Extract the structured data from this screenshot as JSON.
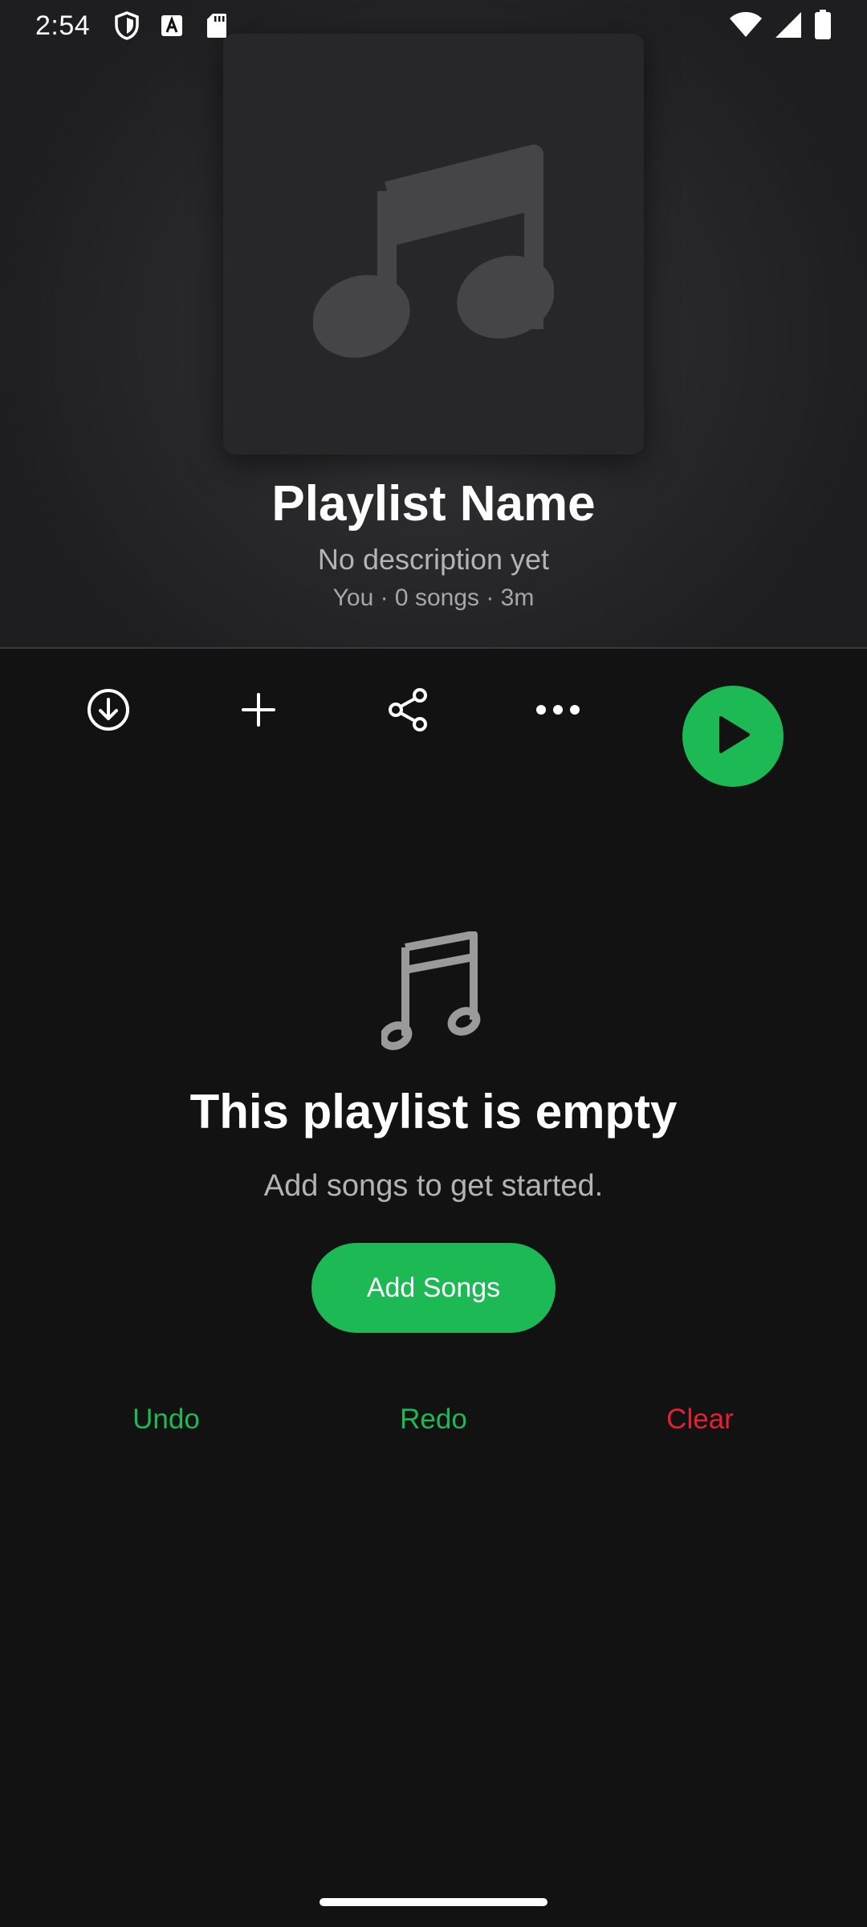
{
  "status_bar": {
    "time": "2:54",
    "icons_left": [
      "shield-icon",
      "font-a-icon",
      "sd-card-icon"
    ],
    "icons_right": [
      "wifi-icon",
      "signal-icon",
      "battery-icon"
    ]
  },
  "header": {
    "artwork_icon": "music-note-icon",
    "title": "Playlist Name",
    "description": "No description yet",
    "meta": "You · 0 songs · 3m"
  },
  "actions": {
    "download": "download-icon",
    "add": "plus-icon",
    "share": "share-icon",
    "more": "more-icon",
    "play": "play-icon"
  },
  "empty_state": {
    "icon": "music-note-icon",
    "title": "This playlist is empty",
    "subtitle": "Add songs to get started.",
    "add_button_label": "Add Songs"
  },
  "history_controls": {
    "undo_label": "Undo",
    "redo_label": "Redo",
    "clear_label": "Clear"
  },
  "colors": {
    "accent_green": "#1db954",
    "danger_red": "#e22134",
    "background": "#121212"
  }
}
